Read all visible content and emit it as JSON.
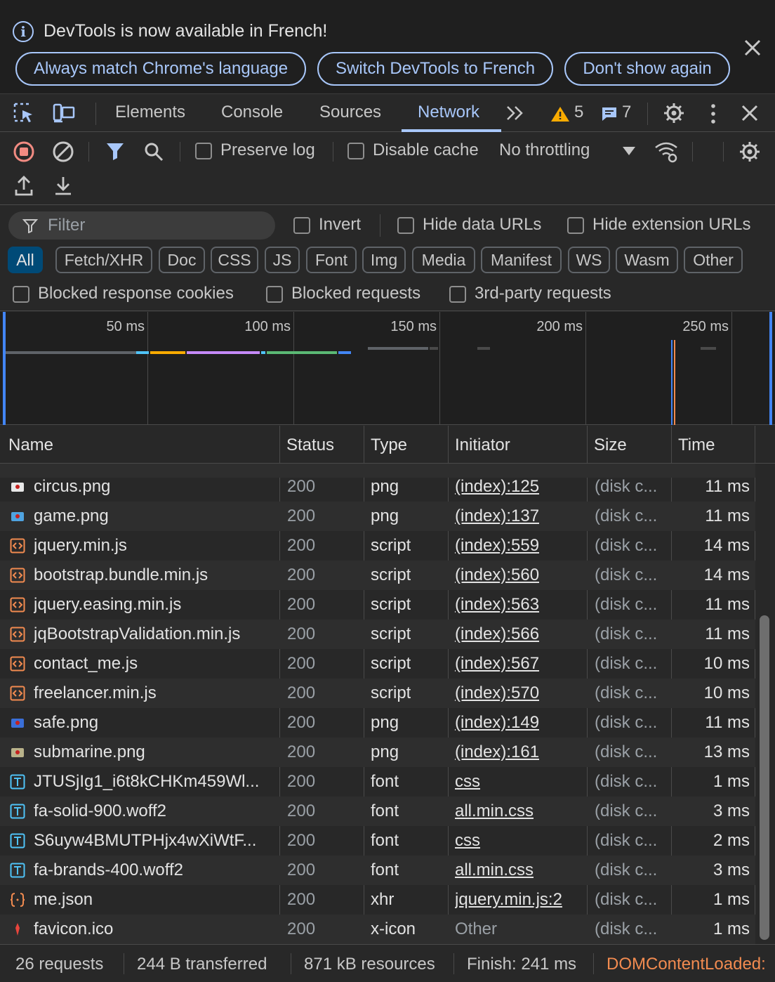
{
  "banner": {
    "message": "DevTools is now available in French!",
    "buttons": [
      "Always match Chrome's language",
      "Switch DevTools to French",
      "Don't show again"
    ]
  },
  "tabs": {
    "items": [
      "Elements",
      "Console",
      "Sources",
      "Network"
    ],
    "active": "Network",
    "warnings_count": "5",
    "messages_count": "7"
  },
  "network_toolbar": {
    "preserve_log": "Preserve log",
    "disable_cache": "Disable cache",
    "throttling": "No throttling"
  },
  "filter": {
    "placeholder": "Filter",
    "invert": "Invert",
    "hide_data_urls": "Hide data URLs",
    "hide_extension_urls": "Hide extension URLs",
    "type_chips": [
      "All",
      "Fetch/XHR",
      "Doc",
      "CSS",
      "JS",
      "Font",
      "Img",
      "Media",
      "Manifest",
      "WS",
      "Wasm",
      "Other"
    ],
    "active_chip": "All",
    "blocked_response_cookies": "Blocked response cookies",
    "blocked_requests": "Blocked requests",
    "third_party_requests": "3rd-party requests"
  },
  "overview": {
    "tick_labels": [
      "50 ms",
      "100 ms",
      "150 ms",
      "200 ms",
      "250 ms"
    ],
    "colors": {
      "waiting": "#5f6368",
      "dns": "#4fc3f7",
      "connect": "#f9ab00",
      "ssl": "#c58af9",
      "ttfb": "#5bb974",
      "download": "#4285f4",
      "dcl": "#4285f4",
      "load": "#f28b50"
    }
  },
  "table": {
    "headers": {
      "name": "Name",
      "status": "Status",
      "type": "Type",
      "initiator": "Initiator",
      "size": "Size",
      "time": "Time"
    },
    "rows": [
      {
        "name": "circus.png",
        "status": "200",
        "type": "png",
        "initiator": "(index):125",
        "size": "(disk c...",
        "time": "11 ms",
        "icon": "image-icon"
      },
      {
        "name": "game.png",
        "status": "200",
        "type": "png",
        "initiator": "(index):137",
        "size": "(disk c...",
        "time": "11 ms",
        "icon": "image-icon"
      },
      {
        "name": "jquery.min.js",
        "status": "200",
        "type": "script",
        "initiator": "(index):559",
        "size": "(disk c...",
        "time": "14 ms",
        "icon": "script-icon"
      },
      {
        "name": "bootstrap.bundle.min.js",
        "status": "200",
        "type": "script",
        "initiator": "(index):560",
        "size": "(disk c...",
        "time": "14 ms",
        "icon": "script-icon"
      },
      {
        "name": "jquery.easing.min.js",
        "status": "200",
        "type": "script",
        "initiator": "(index):563",
        "size": "(disk c...",
        "time": "11 ms",
        "icon": "script-icon"
      },
      {
        "name": "jqBootstrapValidation.min.js",
        "status": "200",
        "type": "script",
        "initiator": "(index):566",
        "size": "(disk c...",
        "time": "11 ms",
        "icon": "script-icon"
      },
      {
        "name": "contact_me.js",
        "status": "200",
        "type": "script",
        "initiator": "(index):567",
        "size": "(disk c...",
        "time": "10 ms",
        "icon": "script-icon"
      },
      {
        "name": "freelancer.min.js",
        "status": "200",
        "type": "script",
        "initiator": "(index):570",
        "size": "(disk c...",
        "time": "10 ms",
        "icon": "script-icon"
      },
      {
        "name": "safe.png",
        "status": "200",
        "type": "png",
        "initiator": "(index):149",
        "size": "(disk c...",
        "time": "11 ms",
        "icon": "image-icon"
      },
      {
        "name": "submarine.png",
        "status": "200",
        "type": "png",
        "initiator": "(index):161",
        "size": "(disk c...",
        "time": "13 ms",
        "icon": "image-icon"
      },
      {
        "name": "JTUSjIg1_i6t8kCHKm459Wl...",
        "status": "200",
        "type": "font",
        "initiator": "css",
        "size": "(disk c...",
        "time": "1 ms",
        "icon": "font-icon"
      },
      {
        "name": "fa-solid-900.woff2",
        "status": "200",
        "type": "font",
        "initiator": "all.min.css",
        "size": "(disk c...",
        "time": "3 ms",
        "icon": "font-icon"
      },
      {
        "name": "S6uyw4BMUTPHjx4wXiWtF...",
        "status": "200",
        "type": "font",
        "initiator": "css",
        "size": "(disk c...",
        "time": "2 ms",
        "icon": "font-icon"
      },
      {
        "name": "fa-brands-400.woff2",
        "status": "200",
        "type": "font",
        "initiator": "all.min.css",
        "size": "(disk c...",
        "time": "3 ms",
        "icon": "font-icon"
      },
      {
        "name": "me.json",
        "status": "200",
        "type": "xhr",
        "initiator": "jquery.min.js:2",
        "size": "(disk c...",
        "time": "1 ms",
        "icon": "json-icon"
      },
      {
        "name": "favicon.ico",
        "status": "200",
        "type": "x-icon",
        "initiator": "Other",
        "size": "(disk c...",
        "time": "1 ms",
        "icon": "favicon-icon"
      }
    ]
  },
  "status_bar": {
    "requests": "26 requests",
    "transferred": "244 B transferred",
    "resources": "871 kB resources",
    "finish": "Finish: 241 ms",
    "dcl": "DOMContentLoaded:"
  }
}
